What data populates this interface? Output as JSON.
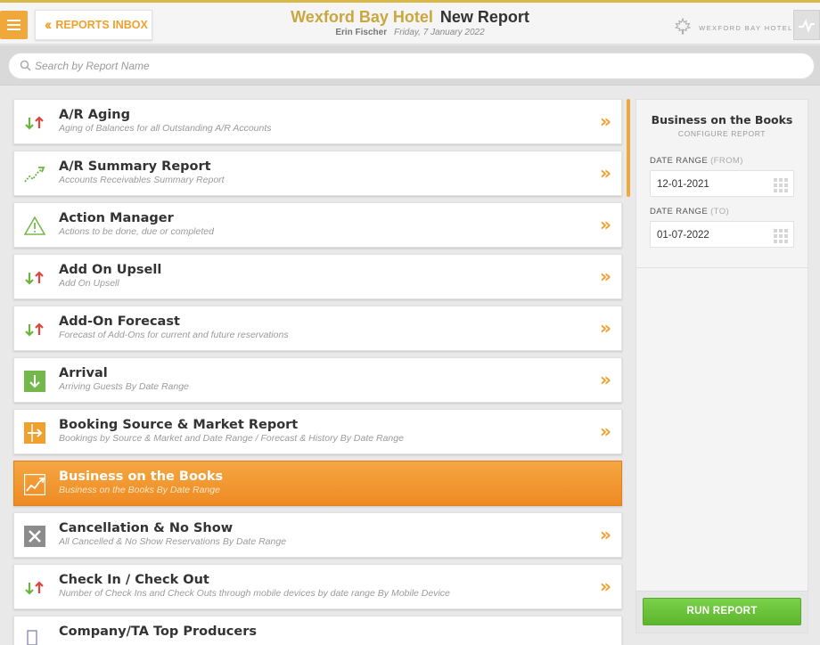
{
  "header": {
    "back_label": "REPORTS INBOX",
    "hotel_name": "Wexford Bay Hotel",
    "page_title": "New Report",
    "user": "Erin Fischer",
    "date": "Friday, 7 January 2022",
    "logo_text": "WEXFORD BAY HOTEL"
  },
  "search": {
    "placeholder": "Search by Report Name"
  },
  "colors": {
    "accent": "#f0a02c",
    "brand": "#c9a73e",
    "run": "#6cc33b"
  },
  "reports": [
    {
      "name": "A/R Aging",
      "desc": "Aging of Balances for all Outstanding A/R Accounts",
      "icon": "up-down-arrows-icon"
    },
    {
      "name": "A/R Summary Report",
      "desc": "Accounts Receivables Summary Report",
      "icon": "trend-line-icon"
    },
    {
      "name": "Action Manager",
      "desc": "Actions to be done, due or completed",
      "icon": "warning-triangle-icon"
    },
    {
      "name": "Add On Upsell",
      "desc": "Add On Upsell",
      "icon": "up-down-arrows-icon"
    },
    {
      "name": "Add-On Forecast",
      "desc": "Forecast of Add-Ons for current and future reservations",
      "icon": "up-down-arrows-icon"
    },
    {
      "name": "Arrival",
      "desc": "Arriving Guests By Date Range",
      "icon": "arrival-icon"
    },
    {
      "name": "Booking Source & Market Report",
      "desc": "Bookings by Source & Market and Date Range / Forecast & History By Date Range",
      "icon": "booking-source-icon"
    },
    {
      "name": "Business on the Books",
      "desc": "Business on the Books By Date Range",
      "icon": "trend-chart-icon"
    },
    {
      "name": "Cancellation & No Show",
      "desc": "All Cancelled & No Show Reservations By Date Range",
      "icon": "cancel-x-icon"
    },
    {
      "name": "Check In / Check Out",
      "desc": "Number of Check Ins and Check Outs through mobile devices by date range By Mobile Device",
      "icon": "up-down-arrows-icon"
    },
    {
      "name": "Company/TA Top Producers",
      "desc": "",
      "icon": "document-icon"
    }
  ],
  "panel": {
    "title": "Business on the Books",
    "subtitle": "CONFIGURE REPORT",
    "from_label": "DATE RANGE",
    "from_paren": "(FROM)",
    "from_value": "12-01-2021",
    "to_label": "DATE RANGE",
    "to_paren": "(TO)",
    "to_value": "01-07-2022",
    "run_label": "RUN REPORT"
  }
}
